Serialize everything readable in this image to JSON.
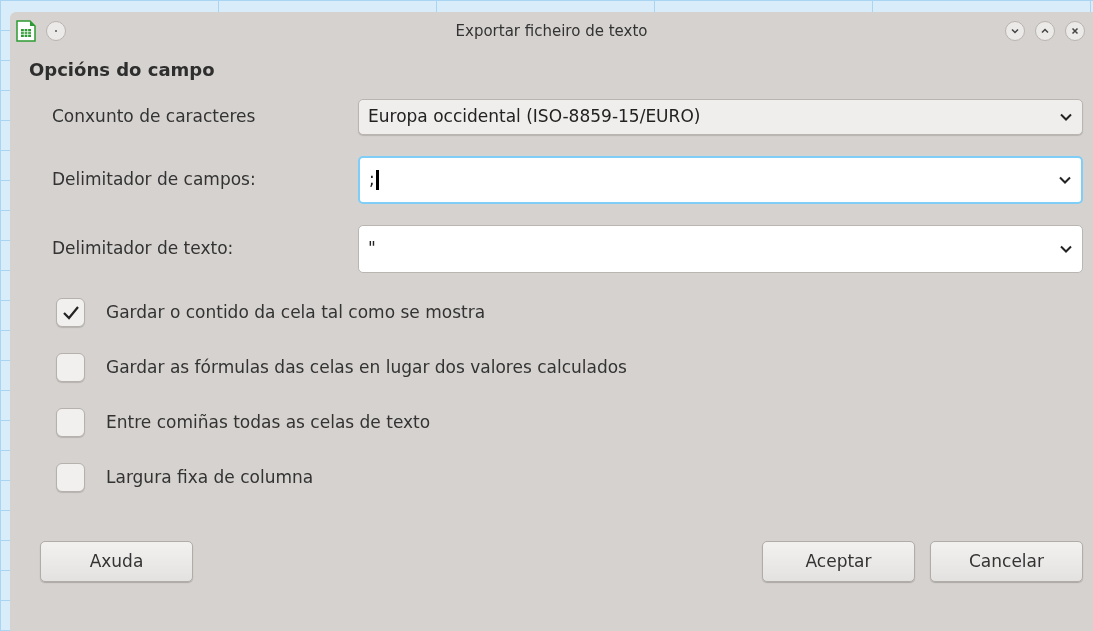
{
  "window": {
    "title": "Exportar ficheiro de texto"
  },
  "section_title": "Opcións do campo",
  "fields": [
    {
      "kind": "select",
      "label": "Conxunto de caracteres",
      "value": "Europa occidental (ISO-8859-15/EURO)",
      "focused": false
    },
    {
      "kind": "combo",
      "label": "Delimitador de campos:",
      "value": ";",
      "focused": true
    },
    {
      "kind": "combo",
      "label": "Delimitador de texto:",
      "value": "\"",
      "focused": false
    }
  ],
  "options": [
    {
      "label": "Gardar o contido da cela tal como se mostra",
      "checked": true
    },
    {
      "label": "Gardar as fórmulas das celas en lugar dos valores calculados",
      "checked": false
    },
    {
      "label": "Entre comiñas todas as celas de texto",
      "checked": false
    },
    {
      "label": "Largura fixa de columna",
      "checked": false
    }
  ],
  "buttons_left": [
    "Axuda"
  ],
  "buttons_right": [
    "Aceptar",
    "Cancelar"
  ]
}
